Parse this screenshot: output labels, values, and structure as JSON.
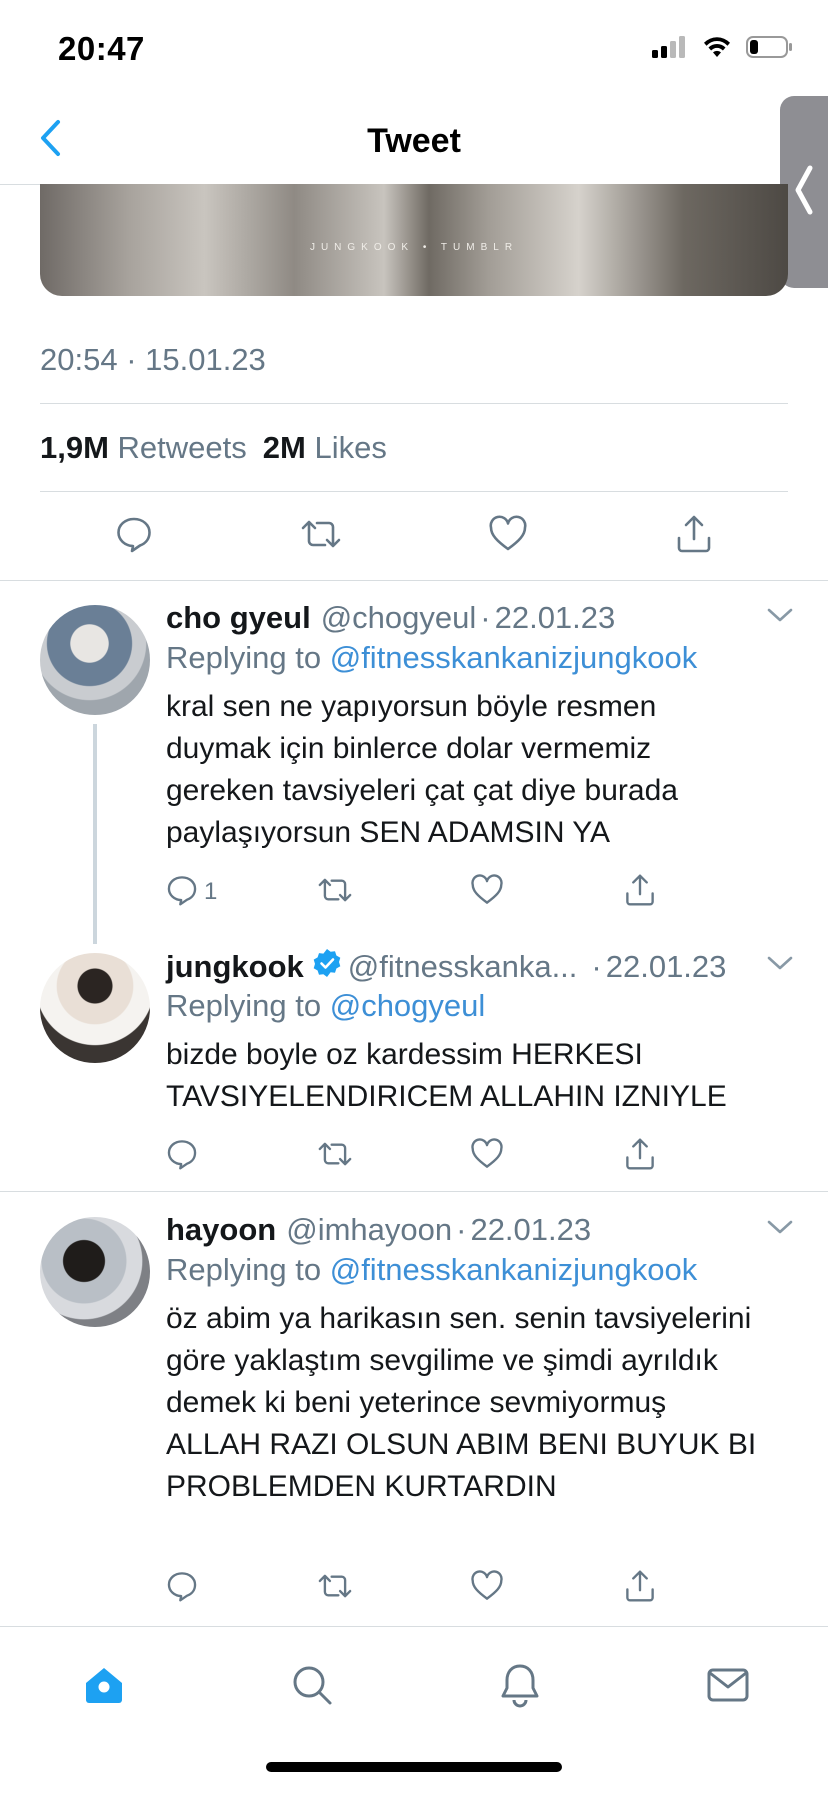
{
  "status_bar": {
    "time": "20:47"
  },
  "header": {
    "title": "Tweet"
  },
  "media": {
    "caption": "JUNGKOOK • TUMBLR"
  },
  "tweet": {
    "timestamp": "20:54 · 15.01.23",
    "retweets_count": "1,9M",
    "retweets_label": "Retweets",
    "likes_count": "2M",
    "likes_label": "Likes"
  },
  "replies": [
    {
      "name": "cho gyeul",
      "handle": "@chogyeul",
      "date": "22.01.23",
      "replying_label": "Replying to",
      "replying_to": "@fitnesskankanizjungkook",
      "text": "kral sen ne yapıyorsun böyle resmen duymak için binlerce dolar vermemiz gereken tavsiyeleri çat çat diye burada paylaşıyorsun SEN ADAMSIN YA",
      "reply_count": "1"
    },
    {
      "name": "jungkook",
      "handle": "@fitnesskanka...",
      "date": "22.01.23",
      "replying_label": "Replying to",
      "replying_to": "@chogyeul",
      "text": "bizde boyle oz kardessim HERKESI TAVSIYELENDIRICEM ALLAHIN IZNIYLE"
    },
    {
      "name": "hayoon",
      "handle": "@imhayoon",
      "date": "22.01.23",
      "replying_label": "Replying to",
      "replying_to": "@fitnesskankanizjungkook",
      "text": "öz abim ya harikasın sen. senin tavsiyelerini göre yaklaştım sevgilime ve şimdi ayrıldık demek ki beni yeterince sevmiyormuş ALLAH RAZI OLSUN ABIM BENI BUYUK BI PROBLEMDEN KURTARDIN"
    }
  ],
  "colors": {
    "accent": "#1da1f2",
    "link": "#3d8fd6",
    "secondary_text": "#657786",
    "divider": "#d8dde0"
  },
  "icons": {
    "nav": [
      "home-icon",
      "search-icon",
      "notifications-icon",
      "messages-icon"
    ],
    "actions": [
      "reply-icon",
      "retweet-icon",
      "like-icon",
      "share-icon"
    ]
  }
}
